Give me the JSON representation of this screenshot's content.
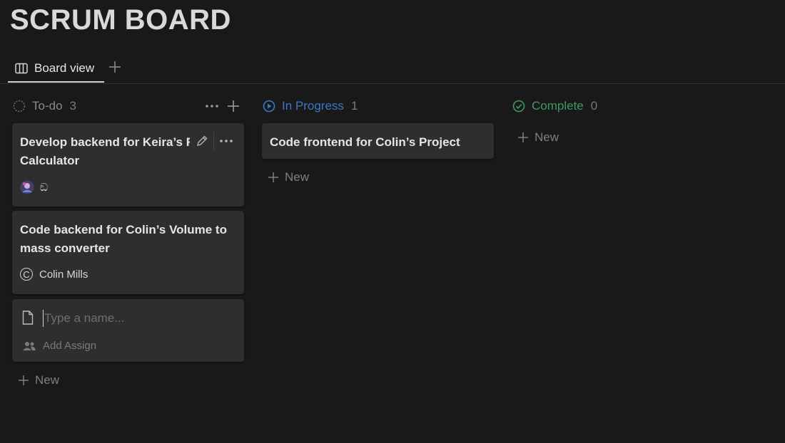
{
  "page": {
    "title": "SCRUM BOARD"
  },
  "tabs": {
    "active_label": "Board view"
  },
  "columns": {
    "todo": {
      "label": "To-do",
      "count": "3",
      "color": "#7d7d7d"
    },
    "in_progress": {
      "label": "In Progress",
      "count": "1",
      "color": "#3b79c6"
    },
    "complete": {
      "label": "Complete",
      "count": "0",
      "color": "#3f9a5f"
    }
  },
  "cards": {
    "card1": {
      "title": "Develop backend for Keira’s Re Calculator",
      "assignee_glyph": "ඞ"
    },
    "card2": {
      "title": "Code backend for Colin’s Volume to mass converter",
      "assignee_initial": "C",
      "assignee": "Colin Mills"
    },
    "card3": {
      "title": "Code frontend for Colin’s Project"
    }
  },
  "new_card": {
    "name_placeholder": "Type a name...",
    "add_assign": "Add Assign"
  },
  "buttons": {
    "new_label": "New"
  }
}
